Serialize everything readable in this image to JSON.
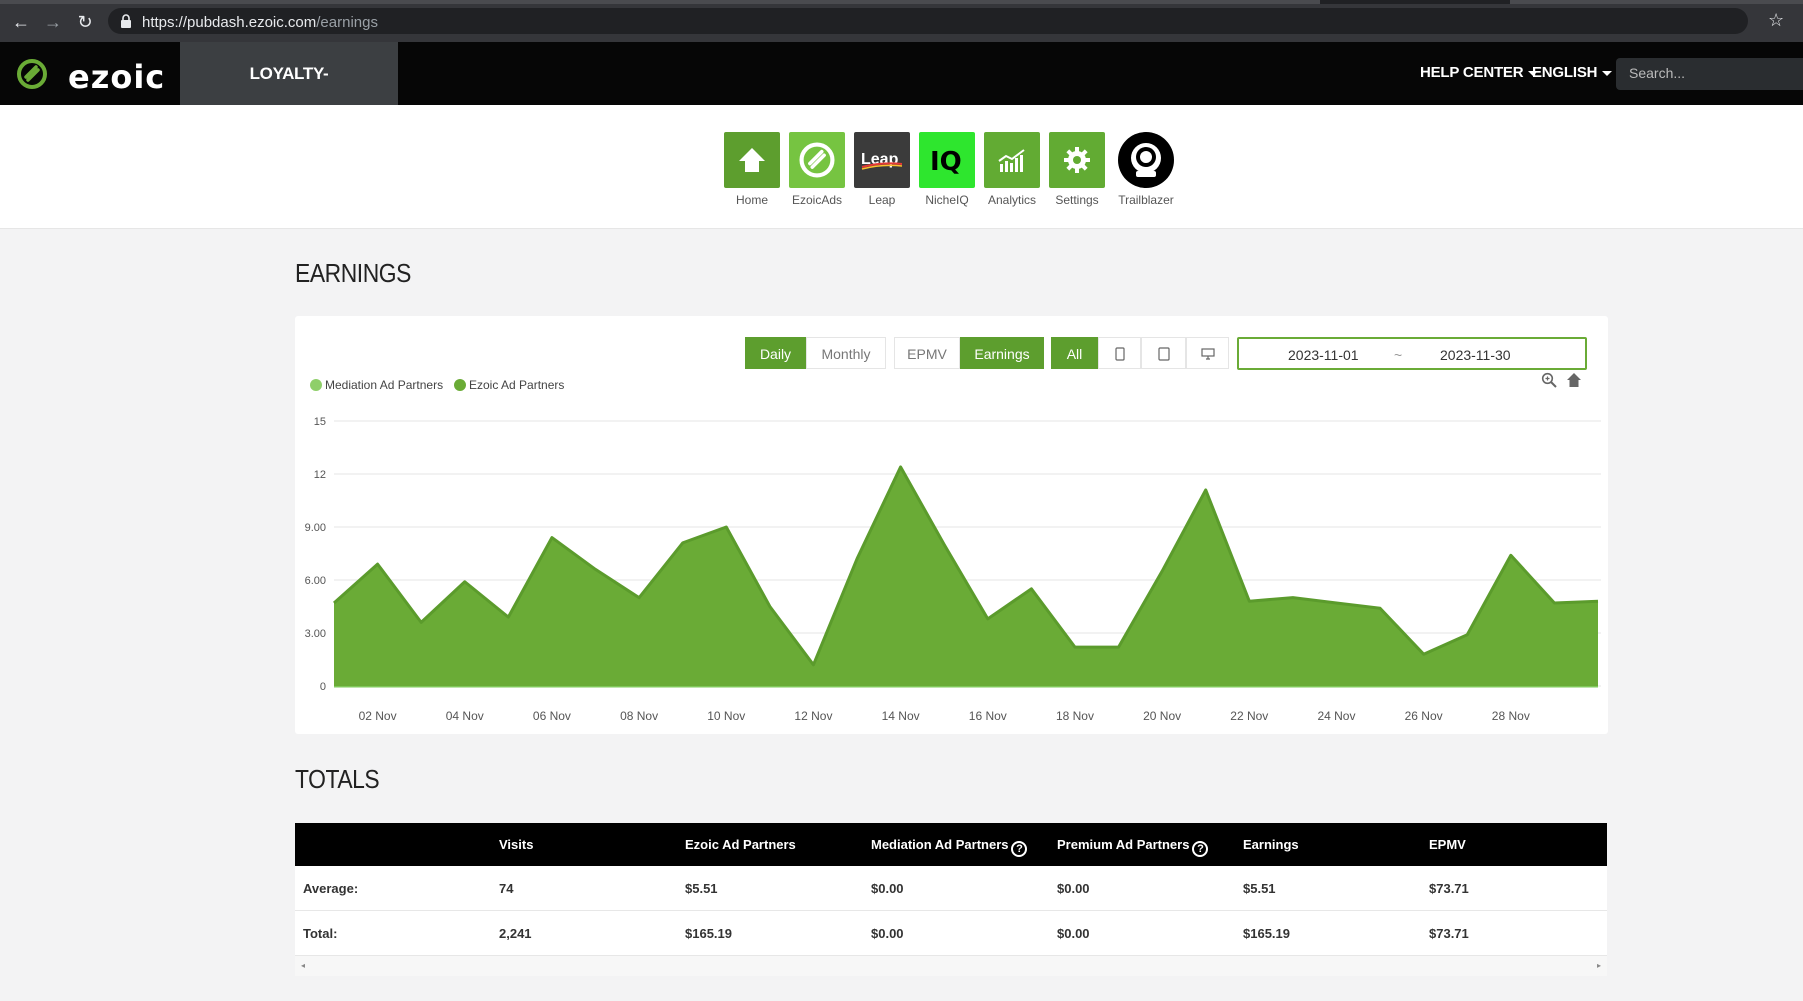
{
  "browser": {
    "url_host": "https://pubdash.ezoic.com",
    "url_path": "/earnings"
  },
  "topbar": {
    "logo_text": "ezoic",
    "site_name": "LOYALTY-PROGRAMS.COM",
    "help_center": "HELP CENTER",
    "language": "ENGLISH",
    "search_placeholder": "Search..."
  },
  "apps": [
    {
      "label": "Home",
      "color": "#5d9e2e"
    },
    {
      "label": "EzoicAds",
      "color": "#76c441"
    },
    {
      "label": "Leap",
      "color": "#3b3b3b"
    },
    {
      "label": "NicheIQ",
      "color": "#2ee62e"
    },
    {
      "label": "Analytics",
      "color": "#62ab33"
    },
    {
      "label": "Settings",
      "color": "#62ab33"
    },
    {
      "label": "Trailblazer",
      "color": "#000000"
    }
  ],
  "earnings": {
    "title": "EARNINGS",
    "buttons": {
      "daily": "Daily",
      "monthly": "Monthly",
      "epmv": "EPMV",
      "earnings": "Earnings",
      "all": "All"
    },
    "date_from": "2023-11-01",
    "date_sep": "~",
    "date_to": "2023-11-30",
    "legend": [
      "Mediation Ad Partners",
      "Ezoic Ad Partners"
    ]
  },
  "chart_data": {
    "type": "area",
    "x": [
      "01 Nov",
      "02 Nov",
      "03 Nov",
      "04 Nov",
      "05 Nov",
      "06 Nov",
      "07 Nov",
      "08 Nov",
      "09 Nov",
      "10 Nov",
      "11 Nov",
      "12 Nov",
      "13 Nov",
      "14 Nov",
      "15 Nov",
      "16 Nov",
      "17 Nov",
      "18 Nov",
      "19 Nov",
      "20 Nov",
      "21 Nov",
      "22 Nov",
      "23 Nov",
      "24 Nov",
      "25 Nov",
      "26 Nov",
      "27 Nov",
      "28 Nov",
      "29 Nov",
      "30 Nov"
    ],
    "x_tick_labels": [
      "02 Nov",
      "04 Nov",
      "06 Nov",
      "08 Nov",
      "10 Nov",
      "12 Nov",
      "14 Nov",
      "16 Nov",
      "18 Nov",
      "20 Nov",
      "22 Nov",
      "24 Nov",
      "26 Nov",
      "28 Nov"
    ],
    "y_tick_labels": [
      "0",
      "3.00",
      "6.00",
      "9.00",
      "12",
      "15"
    ],
    "ylim": [
      0,
      15
    ],
    "series": [
      {
        "name": "Mediation Ad Partners",
        "color": "#8fcf6a",
        "values": [
          0,
          0,
          0,
          0,
          0,
          0,
          0,
          0,
          0,
          0,
          0,
          0,
          0,
          0,
          0,
          0,
          0,
          0,
          0,
          0,
          0,
          0,
          0,
          0,
          0,
          0,
          0,
          0,
          0,
          0
        ]
      },
      {
        "name": "Ezoic Ad Partners",
        "color": "#6aab36",
        "values": [
          4.7,
          6.9,
          3.6,
          5.9,
          3.9,
          8.4,
          6.6,
          5.0,
          8.1,
          9.0,
          4.5,
          1.2,
          7.2,
          12.4,
          8.0,
          3.8,
          5.5,
          2.2,
          2.2,
          6.5,
          11.1,
          4.8,
          5.0,
          4.7,
          4.4,
          1.8,
          2.9,
          7.4,
          4.7,
          4.8
        ]
      }
    ],
    "grid": true,
    "legend_position": "top-left"
  },
  "totals": {
    "title": "TOTALS",
    "columns": [
      "",
      "Visits",
      "Ezoic Ad Partners",
      "Mediation Ad Partners",
      "Premium Ad Partners",
      "Earnings",
      "EPMV"
    ],
    "help_mark": "?",
    "rows": [
      [
        "Average:",
        "74",
        "$5.51",
        "$0.00",
        "$0.00",
        "$5.51",
        "$73.71"
      ],
      [
        "Total:",
        "2,241",
        "$165.19",
        "$0.00",
        "$0.00",
        "$165.19",
        "$73.71"
      ]
    ],
    "scroll_left": "◂",
    "scroll_right": "▸"
  }
}
